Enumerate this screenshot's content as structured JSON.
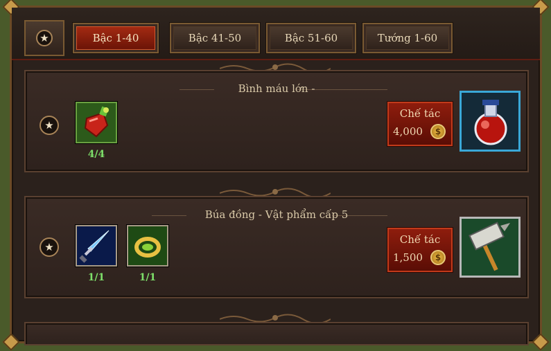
{
  "tabs": [
    {
      "label": "Bậc 1-40",
      "active": true
    },
    {
      "label": "Bậc 41-50",
      "active": false
    },
    {
      "label": "Bậc 51-60",
      "active": false
    },
    {
      "label": "Tướng 1-60",
      "active": false
    }
  ],
  "favorites_tab_icon": "star-icon",
  "recipes": [
    {
      "title": "Bình máu lớn -",
      "ingredients": [
        {
          "icon": "green-potion-icon",
          "qty": "4/4"
        }
      ],
      "craft_label": "Chế tác",
      "price": "4,000",
      "coin_symbol": "$",
      "result_icon": "red-potion-icon"
    },
    {
      "title": "Búa đồng - Vật phẩm cấp 5",
      "ingredients": [
        {
          "icon": "blue-sword-icon",
          "qty": "1/1"
        },
        {
          "icon": "gold-ring-icon",
          "qty": "1/1"
        }
      ],
      "craft_label": "Chế tác",
      "price": "1,500",
      "coin_symbol": "$",
      "result_icon": "war-hammer-icon"
    }
  ],
  "star_glyph": "★",
  "colors": {
    "accent_red": "#8e1d0d",
    "qty_green": "#7ee06a",
    "gold": "#f2c24a"
  }
}
